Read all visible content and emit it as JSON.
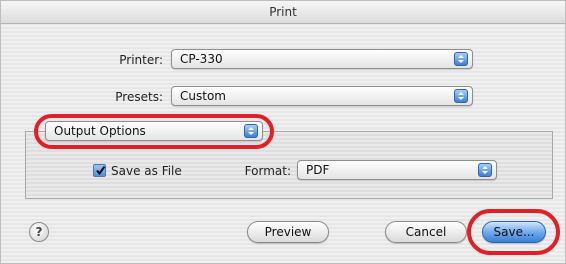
{
  "window": {
    "title": "Print"
  },
  "printer": {
    "label": "Printer:",
    "value": "CP-330"
  },
  "presets": {
    "label": "Presets:",
    "value": "Custom"
  },
  "panel_select": {
    "value": "Output Options"
  },
  "output": {
    "save_as_file": {
      "label": "Save as File",
      "checked": true
    },
    "format": {
      "label": "Format:",
      "value": "PDF"
    }
  },
  "buttons": {
    "help": "?",
    "preview": "Preview",
    "cancel": "Cancel",
    "save": "Save..."
  },
  "colors": {
    "highlight_ring": "#e21f26",
    "accent_blue": "#3b7fd9"
  }
}
